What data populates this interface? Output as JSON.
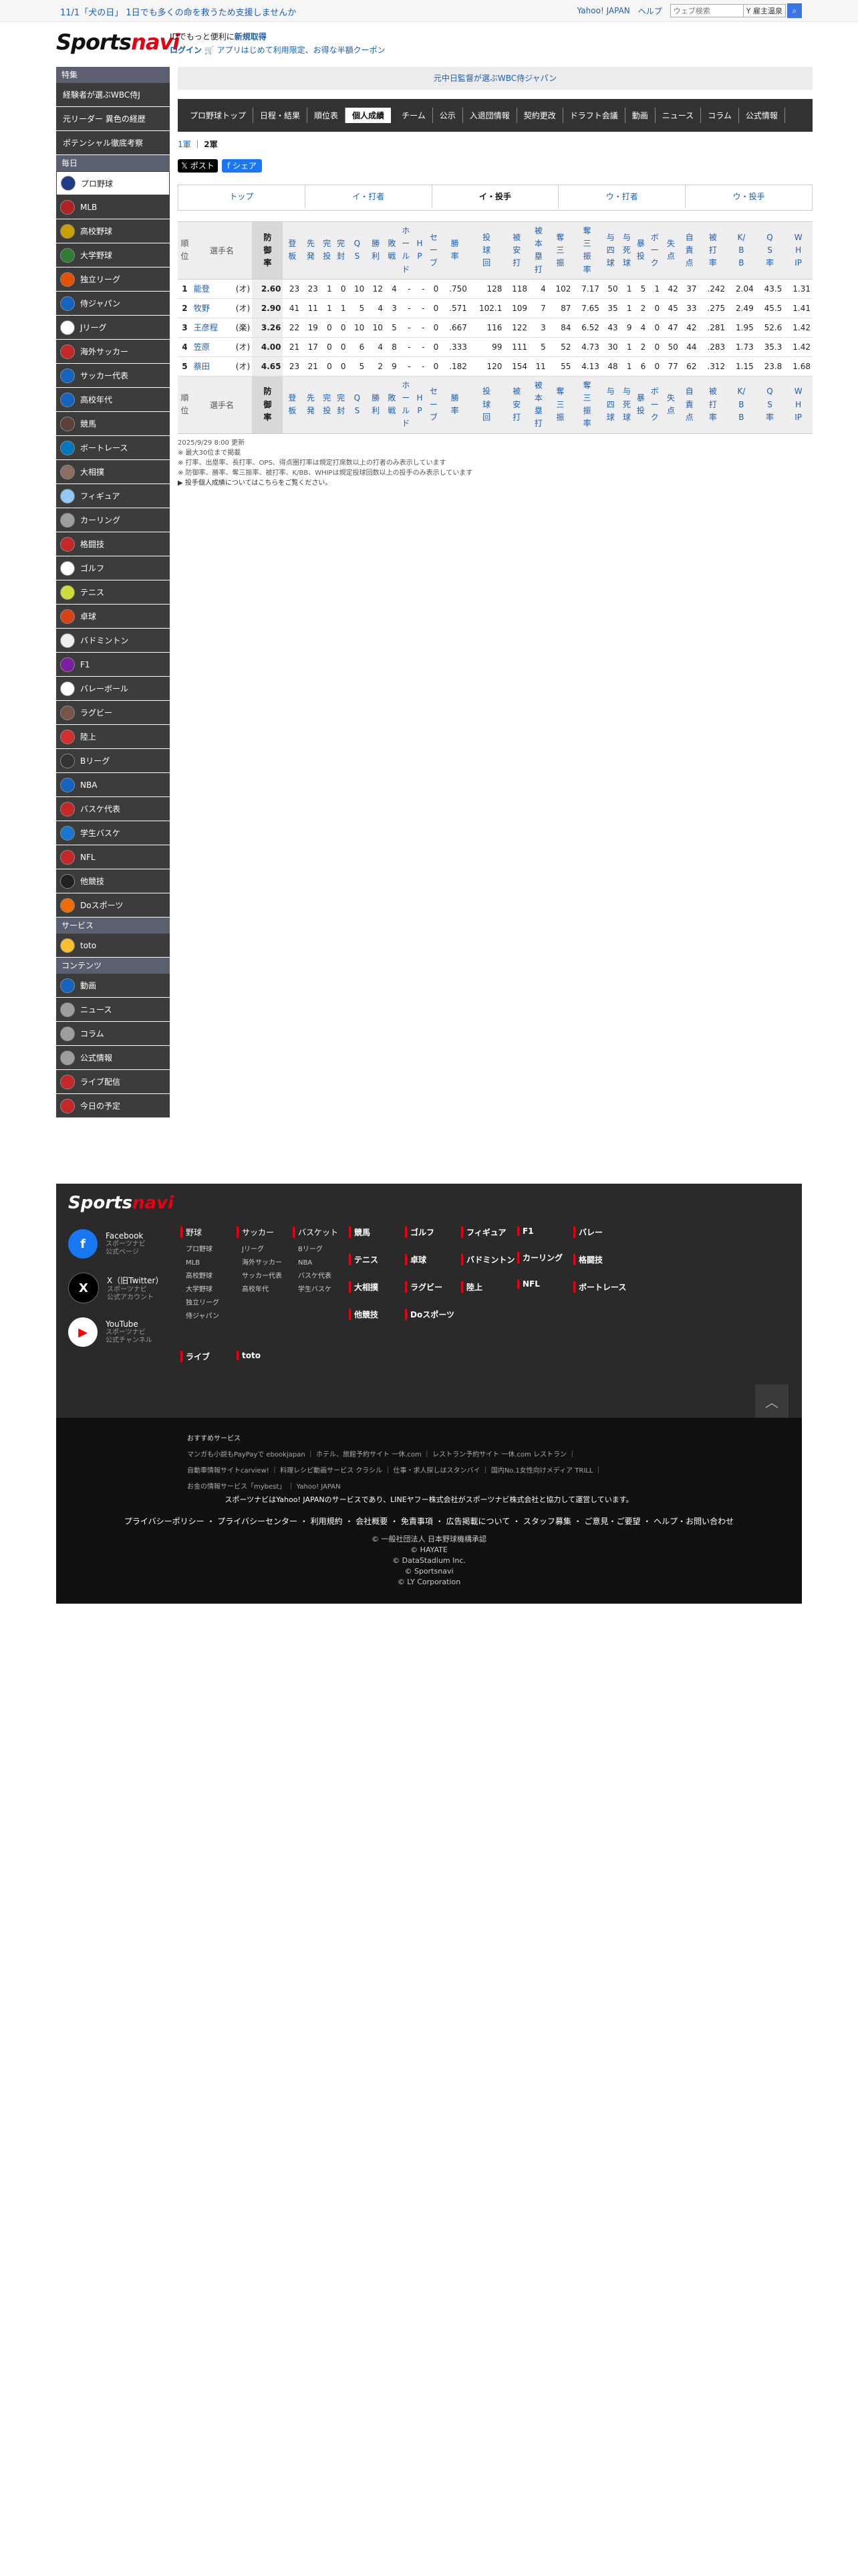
{
  "topbar": {
    "promo": "11/1「犬の日」 1日でも多くの命を救うため支援しませんか",
    "links": [
      "Yahoo! JAPAN",
      "ヘルプ"
    ],
    "search_placeholder": "ウェブ検索",
    "search_scope": "Y 雇主温泉"
  },
  "header": {
    "logo_part1": "Sports",
    "logo_part2": "navi",
    "id_text": "IDでもっと便利に",
    "id_link": "新規取得",
    "login": "ログイン",
    "app_text": "アプリはじめて利用限定、お得な半額クーポン"
  },
  "sidebar": {
    "feature_head": "特集",
    "features": [
      "経験者が選ぶWBC侍J",
      "元リーダー 異色の経歴",
      "ポテンシャル徹底考察"
    ],
    "daily_head": "毎日",
    "sports": [
      {
        "label": "プロ野球",
        "color": "#1f3c88",
        "icon": "baseball-bat-icon"
      },
      {
        "label": "MLB",
        "color": "#b22222",
        "icon": "mlb-icon"
      },
      {
        "label": "高校野球",
        "color": "#c8a000",
        "icon": "highschool-baseball-icon"
      },
      {
        "label": "大学野球",
        "color": "#2e7d32",
        "icon": "college-baseball-icon"
      },
      {
        "label": "独立リーグ",
        "color": "#e65100",
        "icon": "independent-league-icon"
      },
      {
        "label": "侍ジャパン",
        "color": "#1565c0",
        "icon": "samurai-japan-icon"
      },
      {
        "label": "Jリーグ",
        "color": "#ffffff",
        "icon": "soccer-ball-icon"
      },
      {
        "label": "海外サッカー",
        "color": "#c62828",
        "icon": "overseas-soccer-icon"
      },
      {
        "label": "サッカー代表",
        "color": "#1565c0",
        "icon": "soccer-national-icon"
      },
      {
        "label": "高校年代",
        "color": "#1565c0",
        "icon": "youth-soccer-icon"
      },
      {
        "label": "競馬",
        "color": "#5d4037",
        "icon": "horse-racing-icon"
      },
      {
        "label": "ボートレース",
        "color": "#0277bd",
        "icon": "boat-race-icon"
      },
      {
        "label": "大相撲",
        "color": "#8d6e63",
        "icon": "sumo-icon"
      },
      {
        "label": "フィギュア",
        "color": "#90caf9",
        "icon": "figure-skating-icon"
      },
      {
        "label": "カーリング",
        "color": "#9e9e9e",
        "icon": "curling-icon"
      },
      {
        "label": "格闘技",
        "color": "#c62828",
        "icon": "martial-arts-icon"
      },
      {
        "label": "ゴルフ",
        "color": "#ffffff",
        "icon": "golf-icon"
      },
      {
        "label": "テニス",
        "color": "#cddc39",
        "icon": "tennis-icon"
      },
      {
        "label": "卓球",
        "color": "#d84315",
        "icon": "table-tennis-icon"
      },
      {
        "label": "バドミントン",
        "color": "#eeeeee",
        "icon": "badminton-icon"
      },
      {
        "label": "F1",
        "color": "#7b1fa2",
        "icon": "f1-icon"
      },
      {
        "label": "バレーボール",
        "color": "#ffffff",
        "icon": "volleyball-icon"
      },
      {
        "label": "ラグビー",
        "color": "#795548",
        "icon": "rugby-icon"
      },
      {
        "label": "陸上",
        "color": "#d32f2f",
        "icon": "athletics-icon"
      },
      {
        "label": "Bリーグ",
        "color": "#333333",
        "icon": "b-league-icon"
      },
      {
        "label": "NBA",
        "color": "#1565c0",
        "icon": "nba-icon"
      },
      {
        "label": "バスケ代表",
        "color": "#c62828",
        "icon": "basketball-national-icon"
      },
      {
        "label": "学生バスケ",
        "color": "#1976d2",
        "icon": "student-basketball-icon"
      },
      {
        "label": "NFL",
        "color": "#c62828",
        "icon": "nfl-icon"
      },
      {
        "label": "他競技",
        "color": "#212121",
        "icon": "other-sports-icon"
      },
      {
        "label": "Doスポーツ",
        "color": "#ef6c00",
        "icon": "do-sports-icon"
      }
    ],
    "service_head": "サービス",
    "services": [
      {
        "label": "toto",
        "color": "#fbc02d",
        "icon": "toto-icon"
      }
    ],
    "content_head": "コンテンツ",
    "contents": [
      {
        "label": "動画",
        "color": "#1565c0",
        "icon": "video-icon"
      },
      {
        "label": "ニュース",
        "color": "#9e9e9e",
        "icon": "news-icon"
      },
      {
        "label": "コラム",
        "color": "#9e9e9e",
        "icon": "column-icon"
      },
      {
        "label": "公式情報",
        "color": "#9e9e9e",
        "icon": "official-info-icon"
      },
      {
        "label": "ライブ配信",
        "color": "#c62828",
        "icon": "live-icon"
      },
      {
        "label": "今日の予定",
        "color": "#c62828",
        "icon": "calendar-icon"
      }
    ]
  },
  "main": {
    "banner": "元中日監督が選ぶWBC侍ジャパン",
    "nav": [
      "プロ野球トップ",
      "日程・結果",
      "順位表",
      "個人成績",
      "チーム",
      "公示",
      "入退団情報",
      "契約更改",
      "ドラフト会議",
      "動画",
      "ニュース",
      "コラム",
      "公式情報"
    ],
    "nav_active": "個人成績",
    "subnav": [
      "1軍",
      "2軍"
    ],
    "share_x": "ポスト",
    "share_fb": "シェア",
    "tabs": [
      "トップ",
      "イ・打者",
      "イ・投手",
      "ウ・打者",
      "ウ・投手"
    ],
    "tab_active": "イ・投手"
  },
  "table": {
    "headers": [
      "順位",
      "選手名",
      "防御率",
      "登板",
      "先発",
      "完投",
      "完封",
      "QS",
      "勝利",
      "敗戦",
      "ホールド",
      "HP",
      "セーブ",
      "勝率",
      "投球回",
      "被安打",
      "被本塁打",
      "奪三振",
      "奪三振率",
      "与四球",
      "与死球",
      "暴投",
      "ボーク",
      "失点",
      "自責点",
      "被打率",
      "K/BB",
      "QS率",
      "WHIP"
    ],
    "rows": [
      [
        "1",
        "能登",
        "(オ)",
        "2.60",
        "23",
        "23",
        "1",
        "0",
        "10",
        "12",
        "4",
        "-",
        "-",
        "0",
        ".750",
        "128",
        "118",
        "4",
        "102",
        "7.17",
        "50",
        "1",
        "5",
        "1",
        "42",
        "37",
        ".242",
        "2.04",
        "43.5",
        "1.31"
      ],
      [
        "2",
        "牧野",
        "(オ)",
        "2.90",
        "41",
        "11",
        "1",
        "1",
        "5",
        "4",
        "3",
        "-",
        "-",
        "0",
        ".571",
        "102.1",
        "109",
        "7",
        "87",
        "7.65",
        "35",
        "1",
        "2",
        "0",
        "45",
        "33",
        ".275",
        "2.49",
        "45.5",
        "1.41"
      ],
      [
        "3",
        "王彦程",
        "(楽)",
        "3.26",
        "22",
        "19",
        "0",
        "0",
        "10",
        "10",
        "5",
        "-",
        "-",
        "0",
        ".667",
        "116",
        "122",
        "3",
        "84",
        "6.52",
        "43",
        "9",
        "4",
        "0",
        "47",
        "42",
        ".281",
        "1.95",
        "52.6",
        "1.42"
      ],
      [
        "4",
        "笠原",
        "(オ)",
        "4.00",
        "21",
        "17",
        "0",
        "0",
        "6",
        "4",
        "8",
        "-",
        "-",
        "0",
        ".333",
        "99",
        "111",
        "5",
        "52",
        "4.73",
        "30",
        "1",
        "2",
        "0",
        "50",
        "44",
        ".283",
        "1.73",
        "35.3",
        "1.42"
      ],
      [
        "5",
        "蔡田",
        "(オ)",
        "4.65",
        "23",
        "21",
        "0",
        "0",
        "5",
        "2",
        "9",
        "-",
        "-",
        "0",
        ".182",
        "120",
        "154",
        "11",
        "55",
        "4.13",
        "48",
        "1",
        "6",
        "0",
        "77",
        "62",
        ".312",
        "1.15",
        "23.8",
        "1.68"
      ]
    ],
    "notes": [
      "2025/9/29 8:00 更新",
      "※ 最大30位まで掲載",
      "※ 打率、出塁率、長打率、OPS、得点圏打率は規定打席数以上の打者のみ表示しています",
      "※ 防御率、勝率、奪三振率、被打率、K/BB、WHIPは規定投球回数以上の投手のみ表示しています",
      "投手個人成績についてはこちらをご覧ください。"
    ]
  },
  "footer": {
    "logo_part1": "Sports",
    "logo_part2": "navi",
    "social": [
      {
        "name": "Facebook",
        "sub1": "スポーツナビ",
        "sub2": "公式ページ",
        "color": "#1877f2",
        "glyph": "f",
        "icon": "facebook-icon"
      },
      {
        "name": "X（旧Twitter）",
        "sub1": "スポーツナビ",
        "sub2": "公式アカウント",
        "color": "#000000",
        "glyph": "X",
        "icon": "x-icon"
      },
      {
        "name": "YouTube",
        "sub1": "スポーツナビ",
        "sub2": "公式チャンネル",
        "color": "#ff0000",
        "glyph": "▶",
        "icon": "youtube-icon"
      }
    ],
    "cols": [
      {
        "head": "野球",
        "subs": [
          "プロ野球",
          "MLB",
          "高校野球",
          "大学野球",
          "独立リーグ",
          "侍ジャパン"
        ]
      },
      {
        "head": "サッカー",
        "subs": [
          "Jリーグ",
          "海外サッカー",
          "サッカー代表",
          "高校年代"
        ]
      },
      {
        "head": "バスケット",
        "subs": [
          "Bリーグ",
          "NBA",
          "バスケ代表",
          "学生バスケ"
        ]
      },
      {
        "head": "競馬",
        "subs": [],
        "bold_list": [
          "テニス",
          "大相撲",
          "他競技"
        ]
      },
      {
        "head": "ゴルフ",
        "subs": [],
        "bold_list": [
          "卓球",
          "ラグビー",
          "Doスポーツ"
        ]
      },
      {
        "head": "フィギュア",
        "subs": [],
        "bold_list": [
          "バドミントン",
          "陸上"
        ]
      },
      {
        "head": "F1",
        "subs": [],
        "bold_list": [
          "カーリング",
          "NFL"
        ]
      },
      {
        "head": "バレー",
        "subs": [],
        "bold_list": [
          "格闘技",
          "ボートレース"
        ]
      }
    ],
    "extra": [
      "ライブ",
      "toto"
    ],
    "recommend_title": "おすすめサービス",
    "recommend_line1": "マンガも小説もPayPayで ebookjapan ｜ ホテル、旅館予約サイト 一休.com ｜ レストラン予約サイト 一休.com レストラン ｜",
    "recommend_line2": "自動車情報サイトcarview! ｜ 料理レシピ動画サービス クラシル ｜ 仕事・求人探しはスタンバイ ｜ 国内No.1女性向けメディア TRILL ｜",
    "recommend_line3": "お金の情報サービス「mybest」 ｜ Yahoo! JAPAN",
    "ack": "スポーツナビはYahoo! JAPANのサービスであり、LINEヤフー株式会社がスポーツナビ株式会社と協力して運営しています。",
    "links": "プライバシーポリシー ・ プライバシーセンター ・ 利用規約 ・ 会社概要 ・ 免責事項 ・ 広告掲載について ・ スタッフ募集 ・ ご意見・ご要望 ・ ヘルプ・お問い合わせ",
    "copy": [
      "© 一般社団法人 日本野球機構承認",
      "© HAYATE",
      "© DataStadium Inc.",
      "© Sportsnavi",
      "© LY Corporation"
    ]
  }
}
